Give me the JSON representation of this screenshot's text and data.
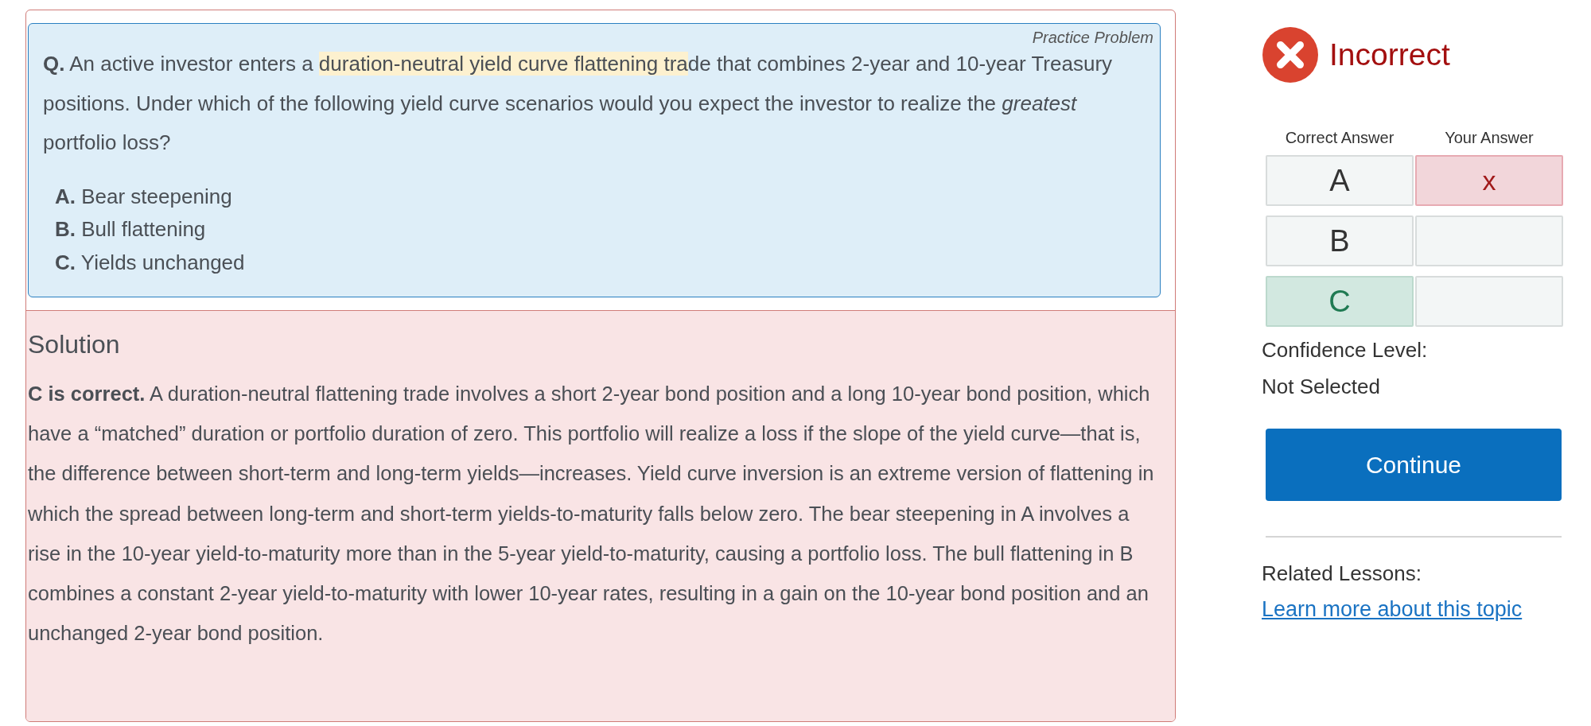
{
  "question": {
    "tag": "Practice Problem",
    "parts": [
      {
        "text": "**Q.** An active investor enters a ",
        "highlighted": false
      },
      {
        "text": "duration-neutral yield curve flattening tra",
        "highlighted": true
      },
      {
        "text": "de that combines 2-year and 10-year Treasury positions. Under which of the following yield curve scenarios would you expect the investor to realize the *greatest* portfolio loss?",
        "highlighted": false
      }
    ],
    "options": [
      "**A.** Bear steepening",
      "**B.** Bull flattening",
      "**C.** Yields unchanged"
    ]
  },
  "solution": {
    "title": "Solution",
    "text": "**C is correct.** A duration-neutral flattening trade involves a short 2-year bond position and a long 10-year bond position, which have a “matched” duration or portfolio duration of zero. This portfolio will realize a loss if the slope of the yield curve—that is, the difference between short-term and long-term yields—increases. Yield curve inversion is an extreme version of flattening in which the spread between long-term and short-term yields-to-maturity falls below zero. The bear steepening in A involves a rise in the 10-year yield-to-maturity more than in the 5-year yield-to-maturity, causing a portfolio loss. The bull flattening in B combines a constant 2-year yield-to-maturity with lower 10-year rates, resulting in a gain on the 10-year bond position and an unchanged 2-year bond position."
  },
  "result": {
    "kind": "incorrect",
    "label": "Incorrect"
  },
  "answers": {
    "columns": [
      "Correct Answer",
      "Your Answer"
    ],
    "rows": [
      {
        "letter": "A",
        "correct": false,
        "chosen": true,
        "mark": "x"
      },
      {
        "letter": "B",
        "correct": false,
        "chosen": false
      },
      {
        "letter": "C",
        "correct": true,
        "chosen": false
      }
    ]
  },
  "confidence": {
    "label": "Confidence Level:",
    "value": "Not Selected"
  },
  "continue_button": "Continue",
  "related": {
    "label": "Related Lessons:",
    "link": "Learn more about this topic"
  }
}
